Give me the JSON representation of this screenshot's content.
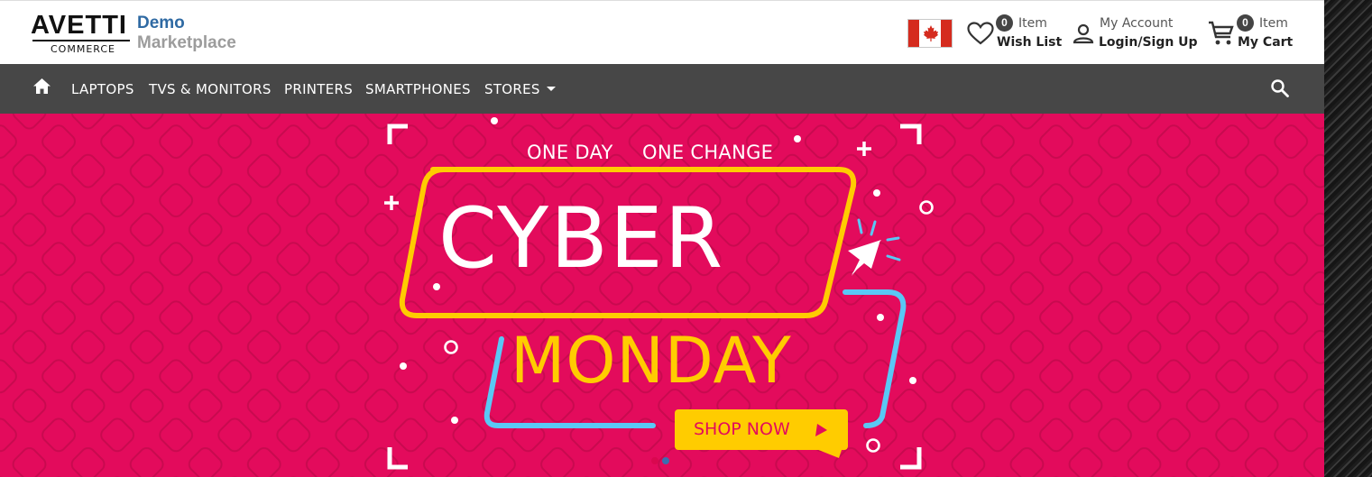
{
  "header": {
    "logo_main": "AVETTI",
    "logo_sub": "COMMERCE",
    "brand_demo": "Demo",
    "brand_marketplace": "Marketplace",
    "flag": "canada-flag",
    "wishlist": {
      "count": "0",
      "top_label": "Item",
      "bottom_label": "Wish List"
    },
    "account": {
      "top_label": "My Account",
      "bottom_label": "Login/Sign Up"
    },
    "cart": {
      "count": "0",
      "top_label": "Item",
      "bottom_label": "My Cart"
    }
  },
  "nav": {
    "items": [
      "LAPTOPS",
      "TVS & MONITORS",
      "PRINTERS",
      "SMARTPHONES",
      "STORES"
    ]
  },
  "banner": {
    "tagline_left": "ONE DAY",
    "tagline_right": "ONE CHANGE",
    "headline": "CYBER",
    "subheadline": "MONDAY",
    "cta": "SHOP NOW",
    "slide_count": 2,
    "active_slide": 2
  },
  "colors": {
    "nav_bg": "#474747",
    "banner_bg": "#e30b5c",
    "accent_yellow": "#ffcc00",
    "accent_blue": "#5ac8f5",
    "brand_blue": "#2f6aa3"
  }
}
